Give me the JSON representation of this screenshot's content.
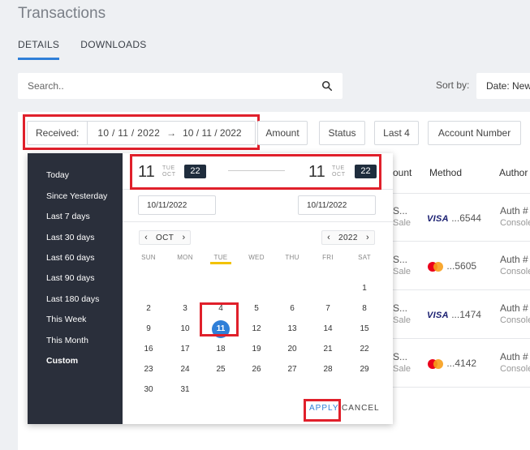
{
  "page": {
    "title": "Transactions"
  },
  "tabs": [
    {
      "label": "DETAILS",
      "active": true
    },
    {
      "label": "DOWNLOADS",
      "active": false
    }
  ],
  "search": {
    "placeholder": "Search.."
  },
  "sort": {
    "label": "Sort by:",
    "value": "Date: Newest"
  },
  "filters": {
    "received_label": "Received:",
    "received_from": "10 / 11 / 2022",
    "arrow": "→",
    "received_to": "10 / 11 / 2022",
    "chips": [
      "Amount",
      "Status",
      "Last 4",
      "Account Number"
    ]
  },
  "table": {
    "headers": [
      "ount",
      "Method",
      "Author"
    ],
    "rows": [
      {
        "amount": "S...",
        "amount_sub": "Sale",
        "brand": "VISA",
        "last4": "...6544",
        "auth": "Auth #",
        "auth_sub": "Console"
      },
      {
        "amount": "S...",
        "amount_sub": "Sale",
        "brand": "mastercard",
        "last4": "...5605",
        "auth": "Auth #",
        "auth_sub": "Console"
      },
      {
        "amount": "S...",
        "amount_sub": "Sale",
        "brand": "VISA",
        "last4": "...1474",
        "auth": "Auth #",
        "auth_sub": "Console"
      },
      {
        "amount": "S...",
        "amount_sub": "Sale",
        "brand": "mastercard",
        "last4": "...4142",
        "auth": "Auth #",
        "auth_sub": "Console"
      }
    ]
  },
  "picker": {
    "presets": [
      "Today",
      "Since Yesterday",
      "Last 7 days",
      "Last 30 days",
      "Last 60 days",
      "Last 90 days",
      "Last 180 days",
      "This Week",
      "This Month",
      "Custom"
    ],
    "start": {
      "day": "11",
      "dow": "TUE",
      "mon": "OCT",
      "year": "22"
    },
    "end": {
      "day": "11",
      "dow": "TUE",
      "mon": "OCT",
      "year": "22"
    },
    "start_input": "10/11/2022",
    "end_input": "10/11/2022",
    "month_nav": {
      "prev": "‹",
      "label": "OCT",
      "next": "›"
    },
    "year_nav": {
      "prev": "‹",
      "label": "2022",
      "next": "›"
    },
    "weekdays": [
      "SUN",
      "MON",
      "TUE",
      "WED",
      "THU",
      "FRI",
      "SAT"
    ],
    "weeks": [
      [
        "",
        "",
        "",
        "",
        "",
        "",
        "1"
      ],
      [
        "2",
        "3",
        "4",
        "5",
        "6",
        "7",
        "8"
      ],
      [
        "9",
        "10",
        "11",
        "12",
        "13",
        "14",
        "15"
      ],
      [
        "16",
        "17",
        "18",
        "19",
        "20",
        "21",
        "22"
      ],
      [
        "23",
        "24",
        "25",
        "26",
        "27",
        "28",
        "29"
      ],
      [
        "30",
        "31",
        "",
        "",
        "",
        "",
        ""
      ]
    ],
    "selected_day": "11",
    "apply_label": "APPLY",
    "cancel_label": "CANCEL"
  }
}
